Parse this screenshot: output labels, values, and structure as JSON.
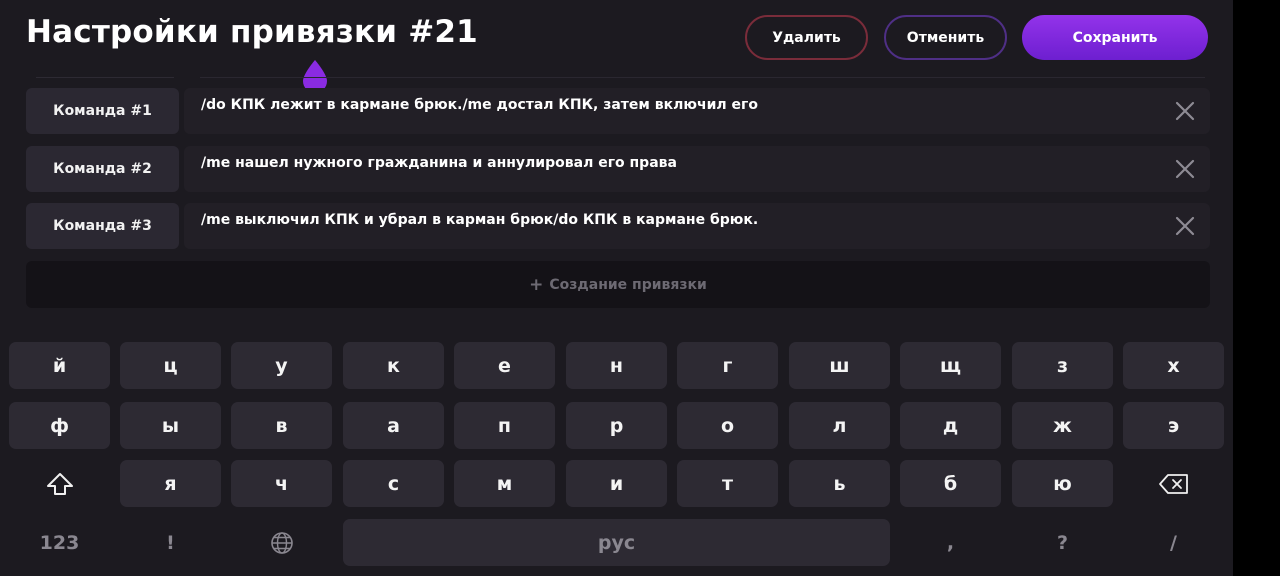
{
  "header": {
    "title": "Настройки привязки #21",
    "delete_label": "Удалить",
    "cancel_label": "Отменить",
    "save_label": "Сохранить"
  },
  "commands": [
    {
      "label": "Команда #1",
      "text": "/do КПК лежит в кармане брюк./me достал КПК, затем включил его"
    },
    {
      "label": "Команда #2",
      "text": "/me нашел нужного гражданина и аннулировал его права"
    },
    {
      "label": "Команда #3",
      "text": "/me выключил КПК и убрал в карман брюк/do КПК в кармане брюк."
    }
  ],
  "create_binding": {
    "icon": "plus-icon",
    "label": "Создание привязки"
  },
  "keyboard": {
    "row1": [
      "й",
      "ц",
      "у",
      "к",
      "е",
      "н",
      "г",
      "ш",
      "щ",
      "з",
      "х"
    ],
    "row2": [
      "ф",
      "ы",
      "в",
      "а",
      "п",
      "р",
      "о",
      "л",
      "д",
      "ж",
      "э"
    ],
    "row3": [
      "я",
      "ч",
      "с",
      "м",
      "и",
      "т",
      "ь",
      "б",
      "ю"
    ],
    "numbers_label": "123",
    "exclamation": "!",
    "space_label": "рус",
    "comma": ",",
    "question": "?",
    "slash": "/",
    "shift_icon": "shift-icon",
    "backspace_icon": "backspace-icon",
    "globe_icon": "globe-icon"
  },
  "colors": {
    "background": "#1c1a20",
    "accent": "#7c22e0",
    "delete_border": "#7a2c3a",
    "cancel_border": "#4f2f86"
  }
}
